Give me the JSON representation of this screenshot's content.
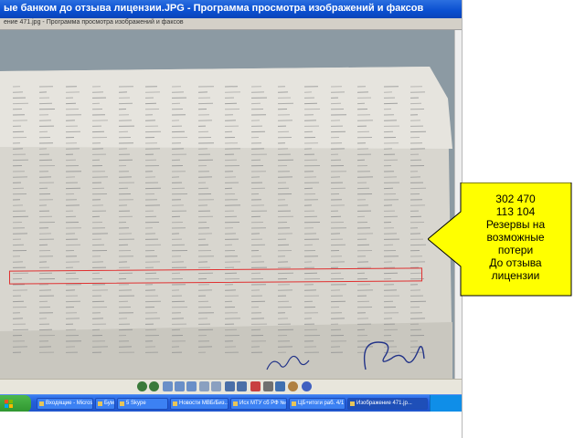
{
  "window": {
    "title": "ые банком до отзыва лицензии.JPG - Программа просмотра изображений и факсов",
    "address": "ение 471.jpg - Программа просмотра изображений и факсов"
  },
  "taskbar": {
    "items": [
      {
        "label": "Входящие - Microsoft..."
      },
      {
        "label": "Бумаги на Бизнесе..."
      },
      {
        "label": "5 Skype"
      },
      {
        "label": "Новости МВБ/Биз..."
      },
      {
        "label": "Исх МТУ сб РФ №..."
      },
      {
        "label": "ЦБ+итоги раб. 4/1 - Р..."
      },
      {
        "label": "Изображение 471.jp..."
      }
    ]
  },
  "callout": {
    "lines": [
      "302 470",
      "113 104",
      "Резервы на",
      "возможные",
      "потери",
      "До отзыва",
      "лицензии"
    ],
    "fill": "#ffff00",
    "border": "#000000"
  },
  "colors": {
    "highlight_row": "#e03030",
    "titlebar": "#0a4fd0",
    "taskbar": "#245edb"
  },
  "icons": {
    "viewer_toolbar": [
      "prev-icon",
      "next-icon",
      "best-fit-icon",
      "actual-size-icon",
      "slideshow-icon",
      "zoom-in-icon",
      "zoom-out-icon",
      "rotate-cw-icon",
      "rotate-ccw-icon",
      "delete-icon",
      "print-icon",
      "save-icon",
      "edit-icon",
      "help-icon"
    ]
  }
}
